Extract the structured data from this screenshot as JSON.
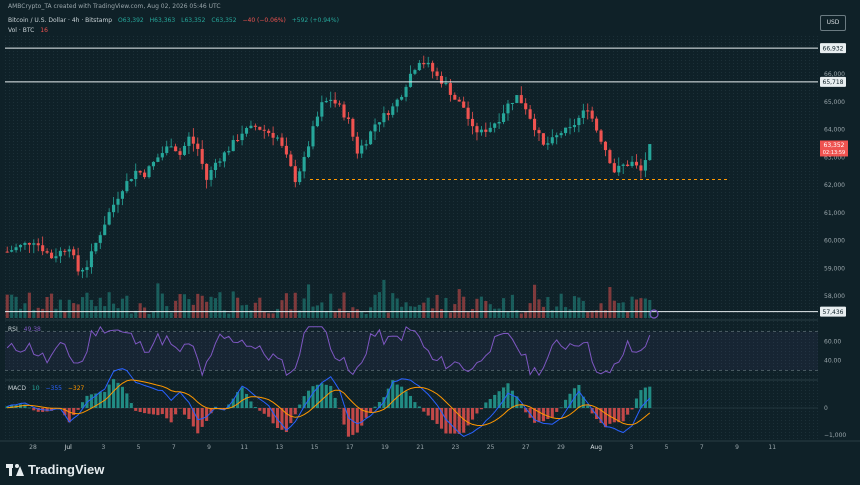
{
  "header": {
    "credit": "AMBCrypto_TA created with TradingView.com, Aug 02, 2026 05:46 UTC",
    "symbol_line": "Bitcoin / U.S. Dollar · 4h · Bitstamp",
    "ohlc": {
      "o": "O63,392",
      "h": "H63,363",
      "l": "L63,352",
      "c": "C63,352",
      "chg": "−40 (−0.06%)",
      "extra": "+592 (+0.94%)"
    },
    "vol_label": "Vol · BTC",
    "vol_value": "16",
    "rsi_label": "RSI",
    "rsi_value": "49.38",
    "macd_label": "MACD",
    "macd_values": [
      "10",
      "−355",
      "−327"
    ]
  },
  "currency": "USD",
  "footer": {
    "brand": "TradingView"
  },
  "colors": {
    "up": "#26a69a",
    "down": "#ef5350",
    "level": "#e8eef0",
    "support": "#ff9800",
    "rsi": "#7e57c2",
    "macd": "#2962ff",
    "signal": "#ff9800",
    "price_badge": "#ef5350",
    "grid": "#1c3038"
  },
  "chart_data": {
    "type": "candlestick",
    "timeframe": "4h",
    "x_tick_labels": [
      "28",
      "Jul",
      "3",
      "5",
      "7",
      "9",
      "11",
      "13",
      "15",
      "17",
      "19",
      "21",
      "23",
      "25",
      "27",
      "29",
      "Aug",
      "3",
      "5",
      "7",
      "9",
      "11"
    ],
    "y_tick_labels": [
      "58,000",
      "59,000",
      "60,000",
      "61,000",
      "62,000",
      "63,000",
      "64,000",
      "65,000",
      "66,000"
    ],
    "ylim": [
      57000,
      67500
    ],
    "levels": [
      {
        "value": 66932,
        "label": "66,932"
      },
      {
        "value": 65718,
        "label": "65,718"
      },
      {
        "value": 57436,
        "label": "57,436"
      }
    ],
    "support_line": {
      "value": 62200,
      "style": "dashed"
    },
    "current_price": {
      "label": "63,352",
      "countdown": "02:13:59"
    },
    "close_path": [
      [
        0,
        59600
      ],
      [
        6,
        60000
      ],
      [
        10,
        59400
      ],
      [
        14,
        59800
      ],
      [
        16,
        58900
      ],
      [
        18,
        59100
      ],
      [
        20,
        59900
      ],
      [
        23,
        61000
      ],
      [
        26,
        61900
      ],
      [
        29,
        62500
      ],
      [
        31,
        62400
      ],
      [
        34,
        63000
      ],
      [
        37,
        63500
      ],
      [
        39,
        63100
      ],
      [
        41,
        63700
      ],
      [
        43,
        63300
      ],
      [
        45,
        62200
      ],
      [
        47,
        62800
      ],
      [
        50,
        63300
      ],
      [
        53,
        63900
      ],
      [
        56,
        64100
      ],
      [
        59,
        63900
      ],
      [
        61,
        63700
      ],
      [
        63,
        63000
      ],
      [
        65,
        62200
      ],
      [
        67,
        62900
      ],
      [
        69,
        64000
      ],
      [
        71,
        64900
      ],
      [
        73,
        65100
      ],
      [
        75,
        64800
      ],
      [
        77,
        64300
      ],
      [
        79,
        63200
      ],
      [
        81,
        63600
      ],
      [
        83,
        64200
      ],
      [
        85,
        64500
      ],
      [
        87,
        64800
      ],
      [
        89,
        65300
      ],
      [
        91,
        66000
      ],
      [
        93,
        66500
      ],
      [
        95,
        66300
      ],
      [
        97,
        65900
      ],
      [
        99,
        65600
      ],
      [
        101,
        65100
      ],
      [
        103,
        64800
      ],
      [
        105,
        64000
      ],
      [
        107,
        63900
      ],
      [
        109,
        64100
      ],
      [
        111,
        64400
      ],
      [
        113,
        64900
      ],
      [
        115,
        65200
      ],
      [
        117,
        64800
      ],
      [
        119,
        64100
      ],
      [
        121,
        63400
      ],
      [
        123,
        63600
      ],
      [
        125,
        63900
      ],
      [
        127,
        64000
      ],
      [
        129,
        64400
      ],
      [
        131,
        64800
      ],
      [
        133,
        64000
      ],
      [
        135,
        63300
      ],
      [
        137,
        62500
      ],
      [
        139,
        62700
      ],
      [
        141,
        62800
      ],
      [
        143,
        62500
      ],
      [
        145,
        63352
      ]
    ],
    "rsi": {
      "ylim": [
        20,
        80
      ],
      "tick_labels": [
        "40.00",
        "60.00"
      ],
      "levels": [
        30,
        70
      ]
    },
    "macd": {
      "tick_labels": [
        "0",
        "−1,000"
      ]
    }
  }
}
